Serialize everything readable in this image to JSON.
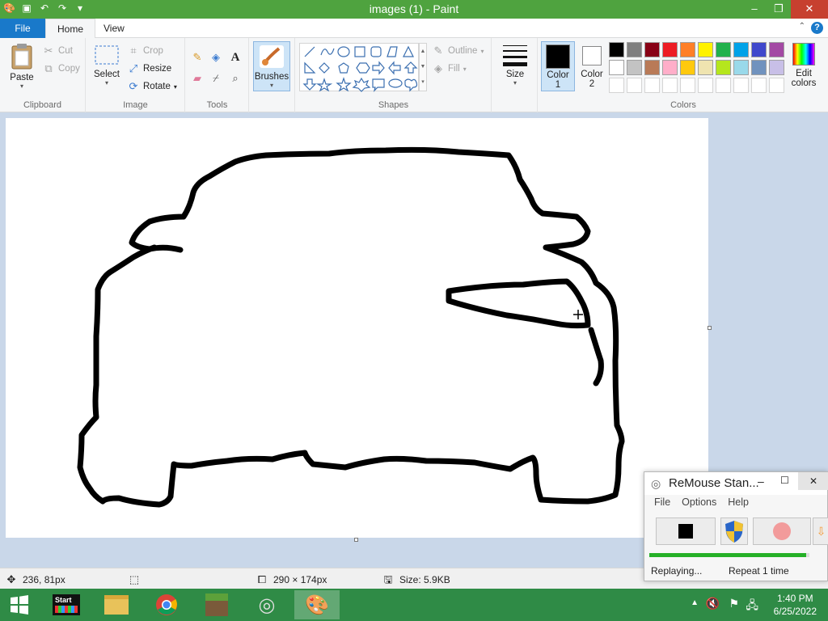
{
  "window": {
    "title": "images (1) - Paint",
    "minimize_glyph": "–",
    "maximize_glyph": "❐",
    "close_glyph": "✕"
  },
  "tabs": {
    "file": "File",
    "home": "Home",
    "view": "View",
    "help_glyph": "?",
    "collapse_glyph": "⌃"
  },
  "clipboard": {
    "paste": "Paste",
    "cut": "Cut",
    "copy": "Copy",
    "group": "Clipboard"
  },
  "image": {
    "select": "Select",
    "crop": "Crop",
    "resize": "Resize",
    "rotate": "Rotate",
    "group": "Image"
  },
  "tools": {
    "group": "Tools",
    "text_glyph": "A"
  },
  "brushes": {
    "label": "Brushes"
  },
  "shapes": {
    "outline": "Outline",
    "fill": "Fill",
    "group": "Shapes"
  },
  "size": {
    "label": "Size"
  },
  "colors": {
    "color1": "Color",
    "color1_num": "1",
    "color2": "Color",
    "color2_num": "2",
    "edit_line1": "Edit",
    "edit_line2": "colors",
    "group": "Colors",
    "color1_value": "#000000",
    "color2_value": "#ffffff",
    "palette_row1": [
      "#000000",
      "#7f7f7f",
      "#880015",
      "#ed1c24",
      "#ff7f27",
      "#fff200",
      "#22b14c",
      "#00a2e8",
      "#3f48cc",
      "#a349a4"
    ],
    "palette_row2": [
      "#ffffff",
      "#c3c3c3",
      "#b97a57",
      "#ffaec9",
      "#ffc90e",
      "#efe4b0",
      "#b5e61d",
      "#99d9ea",
      "#7092be",
      "#c8bfe7"
    ]
  },
  "status": {
    "cursor_pos": "236, 81px",
    "selection_size": "290 × 174px",
    "file_size": "Size: 5.9KB"
  },
  "remouse": {
    "title": "ReMouse Stan...",
    "menu": [
      "File",
      "Options",
      "Help"
    ],
    "state": "Replaying...",
    "repeat": "Repeat 1 time",
    "progress": 0.98
  },
  "taskbar": {
    "start_label": "Start",
    "time": "1:40 PM",
    "date": "6/25/2022"
  }
}
